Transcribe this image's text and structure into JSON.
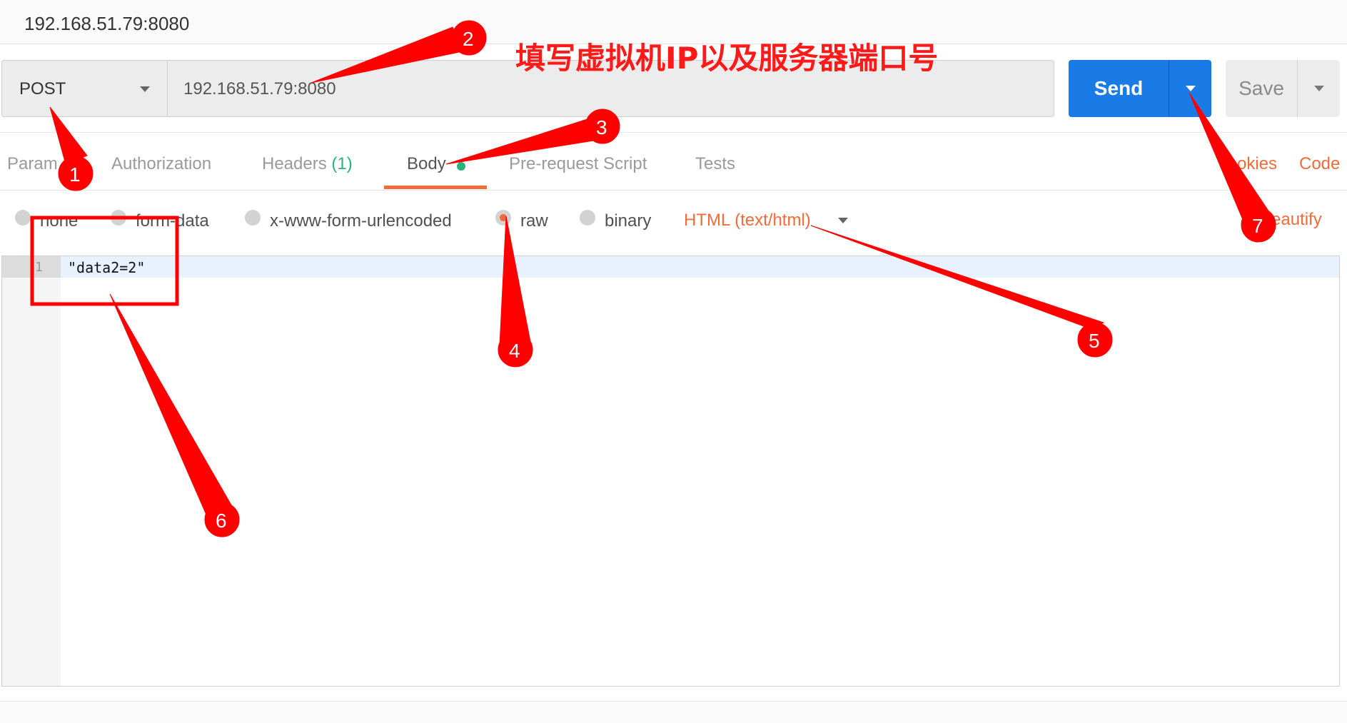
{
  "tab_title": "192.168.51.79:8080",
  "request": {
    "method": "POST",
    "url": "192.168.51.79:8080",
    "send_label": "Send",
    "save_label": "Save"
  },
  "tabs": [
    {
      "label": "Param"
    },
    {
      "label": "Authorization"
    },
    {
      "label": "Headers",
      "count": "(1)"
    },
    {
      "label": "Body"
    },
    {
      "label": "Pre-request Script"
    },
    {
      "label": "Tests"
    }
  ],
  "right_links": {
    "cookies": "okies",
    "code": "Code"
  },
  "body_modes": [
    {
      "label": "none",
      "selected": false
    },
    {
      "label": "form-data",
      "selected": false
    },
    {
      "label": "x-www-form-urlencoded",
      "selected": false
    },
    {
      "label": "raw",
      "selected": true
    },
    {
      "label": "binary",
      "selected": false
    }
  ],
  "content_type": "HTML (text/html)",
  "beautify_label": "eautify",
  "editor": {
    "line_number": "1",
    "code": "\"data2=2\""
  },
  "annotation": {
    "headline": "填写虚拟机IP以及服务器端口号",
    "markers": [
      "1",
      "2",
      "3",
      "4",
      "5",
      "6",
      "7"
    ],
    "color": "#ff0000"
  }
}
